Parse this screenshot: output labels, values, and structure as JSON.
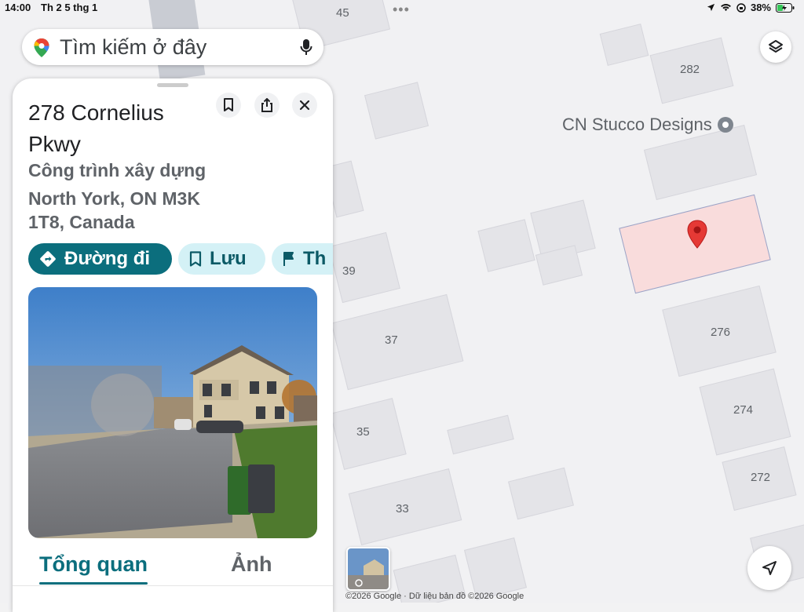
{
  "status_bar": {
    "time": "14:00",
    "date": "Th 2 5 thg 1",
    "battery": "38%"
  },
  "search": {
    "placeholder": "Tìm kiếm ở đây"
  },
  "map": {
    "house_numbers": [
      "45",
      "282",
      "276",
      "274",
      "272",
      "39",
      "37",
      "35",
      "33"
    ],
    "poi_label": "CN Stucco Designs",
    "copyright": "©2026 Google · Dữ liệu bản đồ ©2026 Google"
  },
  "place": {
    "title": "278 Cornelius Pkwy",
    "category": "Công trình xây dựng",
    "address": "North York, ON M3K 1T8, Canada"
  },
  "actions": {
    "directions": "Đường đi",
    "save": "Lưu",
    "share": "Th"
  },
  "tabs": {
    "overview": "Tổng quan",
    "photos": "Ảnh"
  },
  "colors": {
    "accent": "#0b6e7d",
    "chip_bg": "#d4f1f6",
    "marker": "#e53935",
    "selected_parcel": "#f9dcdc"
  }
}
